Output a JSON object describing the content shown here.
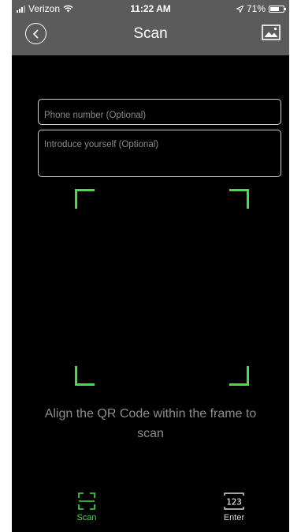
{
  "status_bar": {
    "carrier": "Verizon",
    "time": "11:22 AM",
    "battery_text": "71%",
    "battery_level": 0.71
  },
  "nav": {
    "title": "Scan",
    "back_icon": "chevron-left-circle-icon",
    "gallery_icon": "image-icon"
  },
  "form": {
    "phone_placeholder": "Phone number (Optional)",
    "intro_placeholder": "Introduce yourself (Optional)"
  },
  "scanner": {
    "hint": "Align the QR Code within the frame to scan",
    "frame_color": "#3fe23f"
  },
  "tabs": [
    {
      "label": "Scan",
      "icon": "scan-frame-icon",
      "active": true
    },
    {
      "label": "Enter",
      "icon_text": "123",
      "icon": "keypad-icon",
      "active": false
    }
  ],
  "colors": {
    "accent": "#3fe23f",
    "header_bg": "#5b5b5b",
    "background": "#000000"
  }
}
